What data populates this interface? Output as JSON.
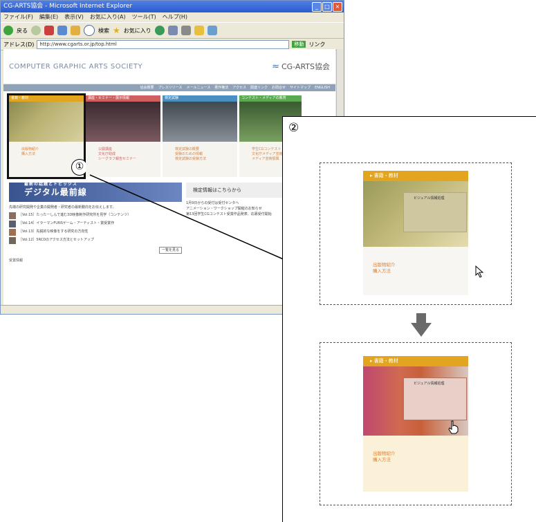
{
  "browser": {
    "title": "CG-ARTS協会 - Microsoft Internet Explorer",
    "window_buttons": [
      "_",
      "□",
      "×"
    ],
    "menu": [
      "ファイル(F)",
      "編集(E)",
      "表示(V)",
      "お気に入り(A)",
      "ツール(T)",
      "ヘルプ(H)"
    ],
    "toolbar": {
      "back": "戻る",
      "search": "検索",
      "favorites": "お気に入り"
    },
    "address_label": "アドレス(D)",
    "address": "http://www.cgarts.or.jp/top.html",
    "go": "移動",
    "links": "リンク"
  },
  "site": {
    "title": "COMPUTER GRAPHIC ARTS SOCIETY",
    "logo": "CG-ARTS協会",
    "nav": [
      "協会概要",
      "プレスリリース",
      "メールニュース",
      "著作権法",
      "アクセス",
      "関連リンク",
      "お問合せ",
      "サイトマップ",
      "ENGLISH"
    ],
    "categories": [
      {
        "tab": "書籍・教材",
        "color": "#e3a520",
        "links": [
          "出版物紹介",
          "購入方法"
        ]
      },
      {
        "tab": "講座・セミナー・展示情報",
        "color": "#d06060",
        "links": [
          "公開講座",
          "文化庁助成",
          "シーグラフ報告セミナー"
        ]
      },
      {
        "tab": "検定試験",
        "color": "#4a8fc0",
        "links": [
          "検定試験の概要",
          "受験のための情報",
          "検定試験の受験方法"
        ]
      },
      {
        "tab": "コンテスト・メディアの教育",
        "color": "#5aa850",
        "links": [
          "学生CGコンテスト",
          "文化庁メディア芸術祭",
          "メディア芸術振興"
        ]
      }
    ],
    "digital_banner": "デジタル最前線",
    "digital_sub": "最新の話題とトピックス",
    "digital_desc": "先端の研究開発や企業の開発者・研究者の最新動向をお伝えします。",
    "news": [
      "［Vol.15］たったーしんで進む3D映像制作研究所を見学（コンテンツ）",
      "［Vol.14］イラーマンFUNSゲーム・アーティスト・賞受賞作",
      "［Vol.13］先鋭的な映像をする研究の方向性",
      "［Vol.12］5RCDのアクセス方法とセットアップ"
    ],
    "more_button": "一覧を見る",
    "cert_info": "検定情報はこちらから",
    "right_items": [
      "1月9日からの受付は受付センタへ",
      "アニメーション・ワークショップ開催のお知らせ",
      "第13回学生CGコンテスト受賞作品発表、応募受付開始"
    ],
    "section_footer": "受賞情報"
  },
  "annotation": {
    "marker1": "①",
    "marker2": "②"
  },
  "zoom": {
    "tab": "書籍・教材",
    "book_label": "ビジュアル情報処理",
    "links": [
      "出版物紹介",
      "購入方法"
    ]
  }
}
